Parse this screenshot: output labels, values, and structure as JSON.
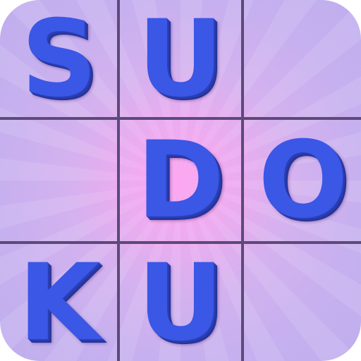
{
  "icon": {
    "name": "Sudoku app icon",
    "background_color": "#c7b0ef",
    "glow_color": "#f7b8f0",
    "grid_line_color": "#5c4a78",
    "letter_color": "#3a57e6"
  },
  "grid": {
    "rows": 3,
    "cols": 3,
    "cells": [
      [
        "S",
        "U",
        ""
      ],
      [
        "",
        "D",
        "O"
      ],
      [
        "K",
        "U",
        ""
      ]
    ]
  }
}
